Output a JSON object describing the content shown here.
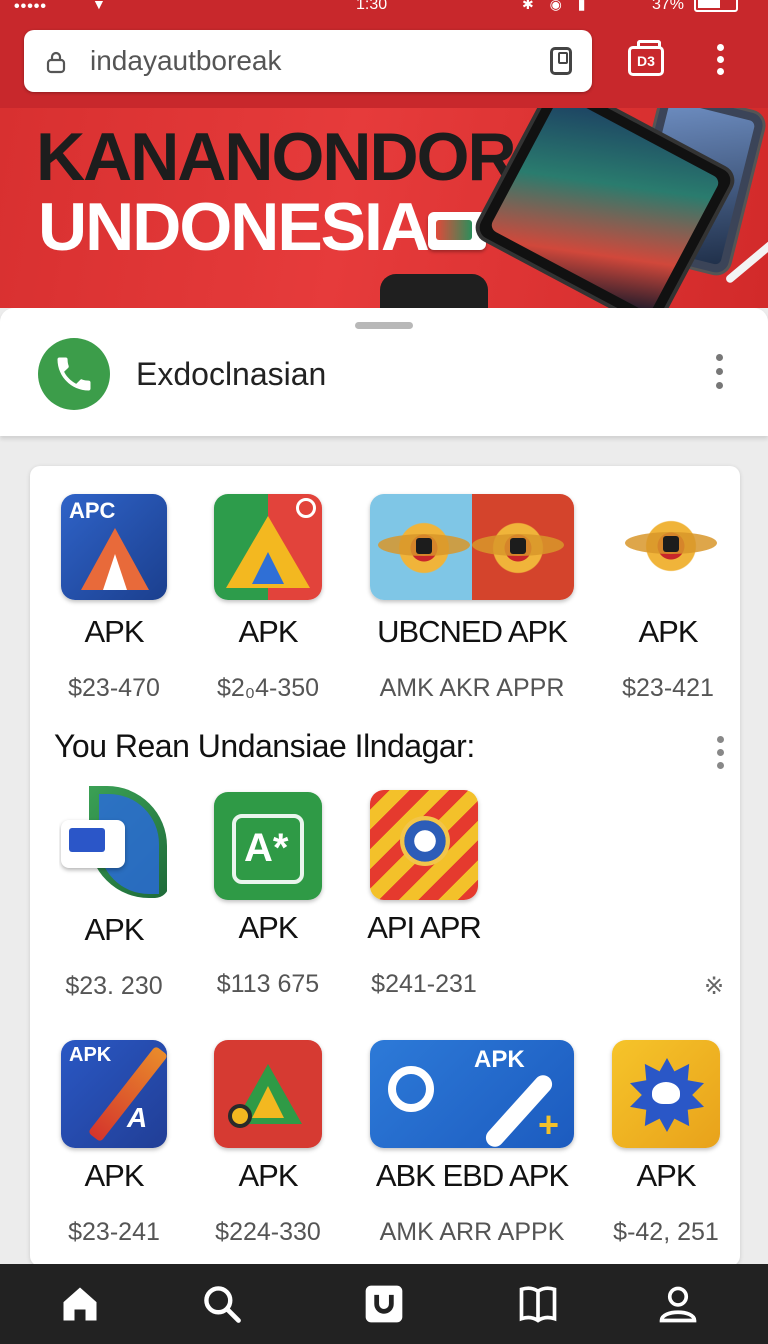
{
  "status_bar": {
    "time": "1:30",
    "battery": "37%"
  },
  "browser": {
    "url": "indayautboreak",
    "tab_count": "D3"
  },
  "banner": {
    "line1": "KANANONDORÁN",
    "line2": "UNDONESIA"
  },
  "sheet": {
    "title": "Exdoclnasian"
  },
  "apps_top": [
    {
      "label": "APK",
      "price": "$23-470",
      "icon": "apc-icon"
    },
    {
      "label": "APK",
      "price": "$2₀4-350",
      "icon": "drive-icon"
    },
    {
      "label": "UBCNED APK",
      "price": "AMK AKR APPR",
      "icon": "garuda-icon"
    },
    {
      "label": "APK",
      "price": "$23-421",
      "icon": "emblem-icon"
    }
  ],
  "section": {
    "title": "You Rean Undansiae Ilndagar:"
  },
  "apps_middle": [
    {
      "label": "APK",
      "price": "$23. 230",
      "icon": "chat-icon"
    },
    {
      "label": "APK",
      "price": "$113 675",
      "icon": "green-a-icon"
    },
    {
      "label": "API APR",
      "price": "$241-231",
      "icon": "stripes-badge-icon"
    }
  ],
  "dismiss_symbol": "※",
  "apps_bottom": [
    {
      "label": "APK",
      "price": "$23-241",
      "icon": "pen-icon"
    },
    {
      "label": "APK",
      "price": "$224-330",
      "icon": "red-a-icon"
    },
    {
      "label": "ABK EBD APK",
      "price": "AMK ARR APPK",
      "icon": "tools-icon"
    },
    {
      "label": "APK",
      "price": "$-42, 251",
      "icon": "sun-face-icon"
    }
  ],
  "icon_tags": {
    "apc": "APC",
    "pen": "APK",
    "wide": "APK"
  },
  "bottom_nav": [
    "home-icon",
    "search-icon",
    "shield-icon",
    "book-icon",
    "profile-icon"
  ],
  "colors": {
    "brand_red": "#c8282c",
    "call_green": "#3c9d4a",
    "nav_bg": "#222222"
  }
}
